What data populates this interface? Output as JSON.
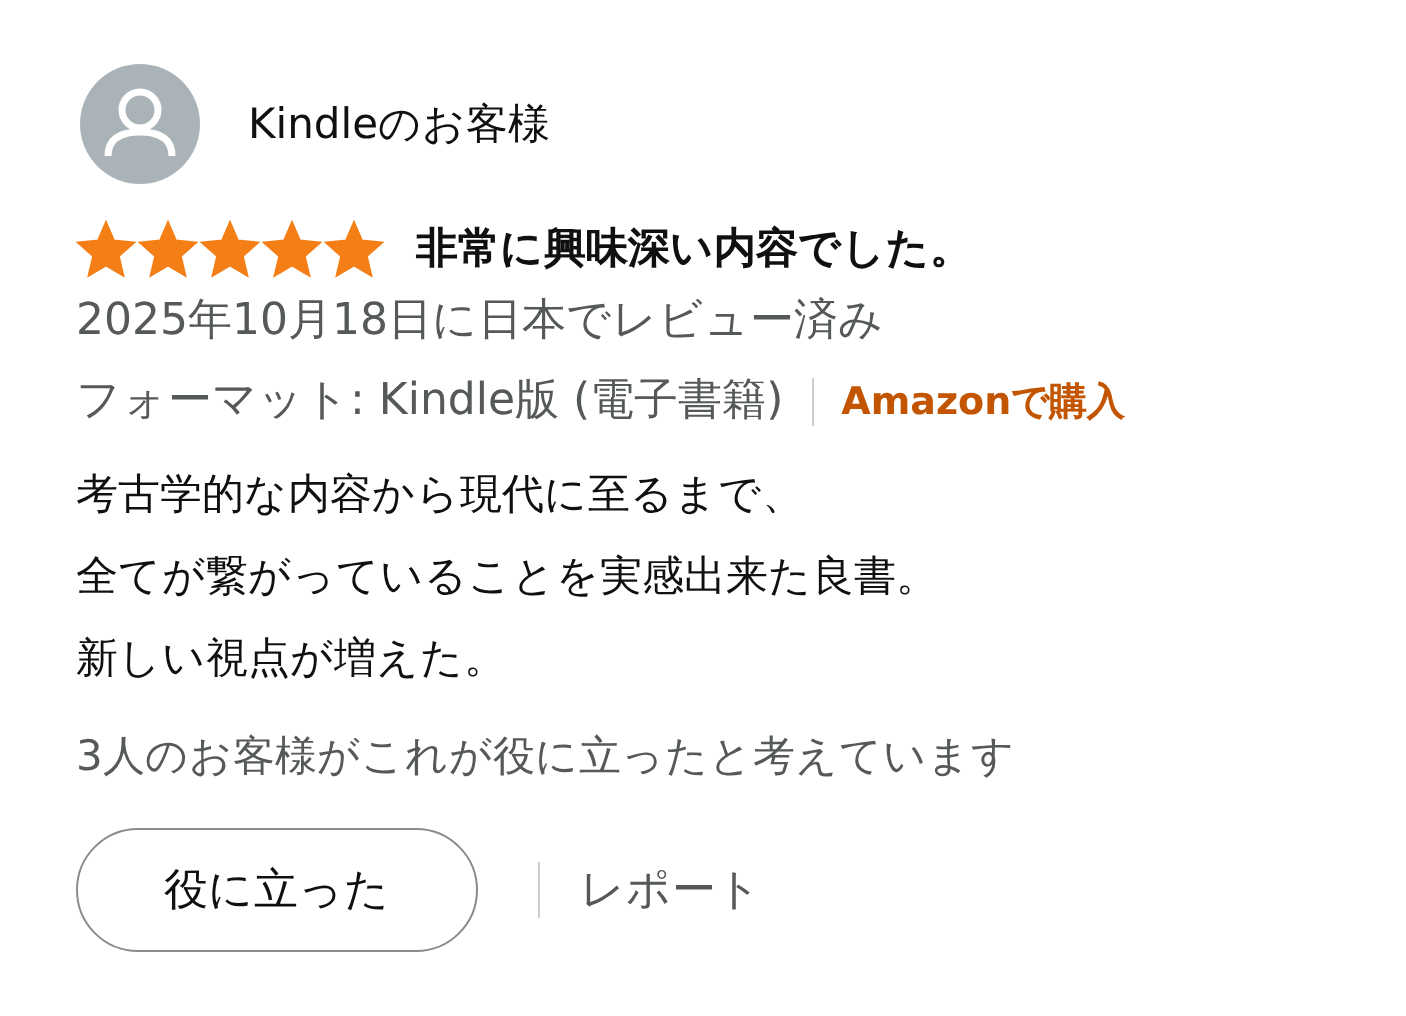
{
  "review": {
    "author": "Kindleのお客様",
    "stars": 5,
    "title": "非常に興味深い内容でした。",
    "date": "2025年10月18日に日本でレビュー済み",
    "format": "フォーマット: Kindle版 (電子書籍)",
    "purchase": "Amazonで購入",
    "body": [
      "考古学的な内容から現代に至るまで、",
      "全てが繋がっていることを実感出来た良書。",
      "新しい視点が増えた。"
    ],
    "helpful_count": "3人のお客様がこれが役に立ったと考えています",
    "helpful_button": "役に立った",
    "report": "レポート"
  }
}
